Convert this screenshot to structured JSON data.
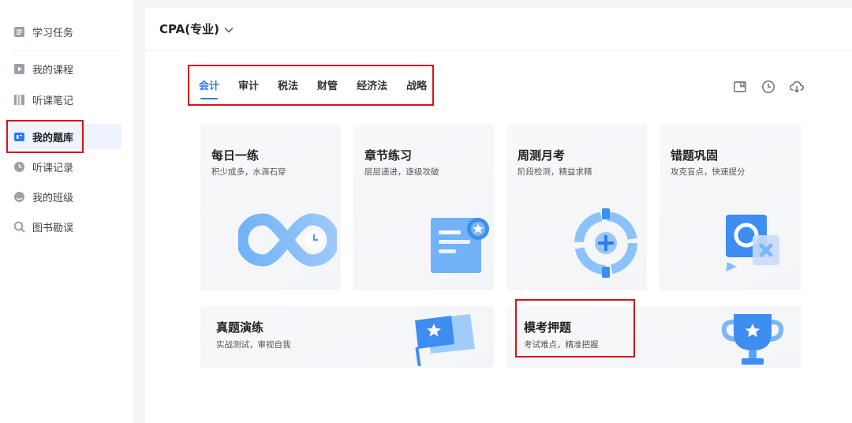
{
  "sidebar": {
    "items": [
      {
        "label": "学习任务",
        "icon": "task-list-icon"
      },
      {
        "label": "我的课程",
        "icon": "play-course-icon"
      },
      {
        "label": "听课笔记",
        "icon": "notes-icon"
      },
      {
        "label": "我的题库",
        "icon": "question-bank-icon"
      },
      {
        "label": "听课记录",
        "icon": "clock-history-icon"
      },
      {
        "label": "我的班级",
        "icon": "class-group-icon"
      },
      {
        "label": "图书勘误",
        "icon": "search-icon"
      }
    ],
    "active_label": "我的题库"
  },
  "header": {
    "course": "CPA(专业)"
  },
  "tabs": [
    {
      "label": "会计"
    },
    {
      "label": "审计"
    },
    {
      "label": "税法"
    },
    {
      "label": "财管"
    },
    {
      "label": "经济法"
    },
    {
      "label": "战略"
    }
  ],
  "active_tab": "会计",
  "toolbar_icons": [
    "folder-icon",
    "clock-icon",
    "cloud-download-icon"
  ],
  "cards": [
    {
      "title": "每日一练",
      "subtitle": "积少成多，水滴石穿",
      "icon": "infinity-icon"
    },
    {
      "title": "章节练习",
      "subtitle": "层层递进，逐级攻破",
      "icon": "document-badge-icon"
    },
    {
      "title": "周测月考",
      "subtitle": "阶段检测，精益求精",
      "icon": "target-icon"
    },
    {
      "title": "错题巩固",
      "subtitle": "攻克盲点，快速提分",
      "icon": "wrong-answer-icon"
    },
    {
      "title": "真题演练",
      "subtitle": "实战测试，审视自我",
      "icon": "flag-icon"
    },
    {
      "title": "模考押题",
      "subtitle": "考试难点，精准把握",
      "icon": "trophy-icon"
    }
  ],
  "colors": {
    "accent": "#2b7bf2",
    "highlight_box": "#d9111a",
    "icon_blue": "#4a9cf5"
  }
}
